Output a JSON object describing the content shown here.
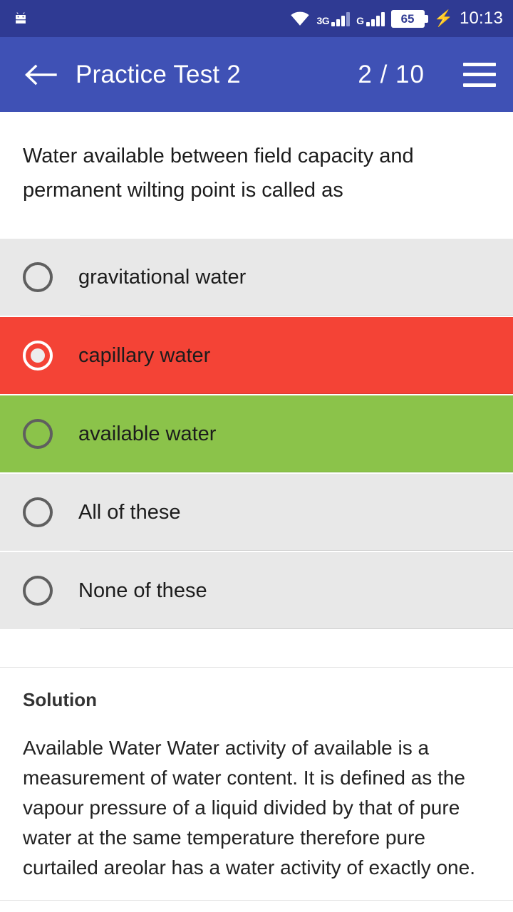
{
  "status_bar": {
    "notification_icon": "android-robot-icon",
    "wifi_icon": "wifi-icon",
    "sim1_network": "3G",
    "sim2_network": "G",
    "battery_level": "65",
    "charging_icon": "charging-bolt-icon",
    "time": "10:13"
  },
  "app_bar": {
    "back_icon": "back-arrow-icon",
    "title": "Practice Test 2",
    "counter": "2  / 10",
    "menu_icon": "hamburger-menu-icon"
  },
  "question": {
    "text": "Water available between field capacity and permanent wilting point is called as"
  },
  "options": [
    {
      "label": "gravitational water",
      "state": "default",
      "selected": false
    },
    {
      "label": "capillary water",
      "state": "wrong",
      "selected": true
    },
    {
      "label": "available water",
      "state": "correct",
      "selected": false
    },
    {
      "label": "All of these",
      "state": "default",
      "selected": false
    },
    {
      "label": "None of these",
      "state": "default",
      "selected": false
    }
  ],
  "solution": {
    "title": "Solution",
    "body": "Available Water Water activity of available is a measurement of water content. It is defined as the vapour pressure of a liquid divided by that of pure water at the same temperature therefore pure curtailed areolar has a water activity of exactly one."
  },
  "colors": {
    "status_bar": "#2f3a93",
    "app_bar": "#3f51b5",
    "option_default": "#e8e8e8",
    "option_correct": "#8bc34a",
    "option_wrong": "#f44336",
    "page_background": "#ffffff"
  }
}
